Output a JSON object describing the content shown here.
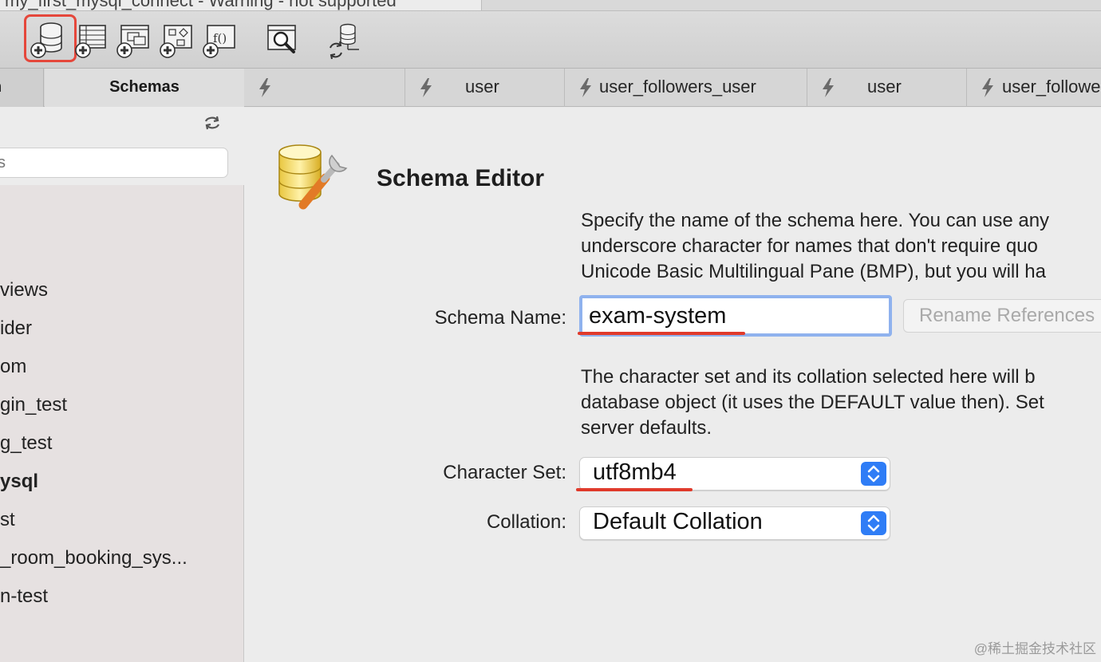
{
  "window": {
    "title": "my_first_mysql_connect - Warning - not supported"
  },
  "toolbar": {
    "buttons": [
      {
        "icon": "new-schema-icon",
        "highlighted": true
      },
      {
        "icon": "new-table-icon"
      },
      {
        "icon": "new-view-icon"
      },
      {
        "icon": "new-procedure-icon"
      },
      {
        "icon": "new-function-icon"
      },
      {
        "icon": "inspector-icon"
      },
      {
        "icon": "reconnect-icon"
      }
    ],
    "highlight_color": "#e5473b"
  },
  "sidebar": {
    "tab_left": "n",
    "tab_schemas": "Schemas",
    "search_placeholder": "s",
    "schemas": [
      {
        "name": "views",
        "bold": false
      },
      {
        "name": "ider",
        "bold": false
      },
      {
        "name": "om",
        "bold": false
      },
      {
        "name": "gin_test",
        "bold": false
      },
      {
        "name": "g_test",
        "bold": false
      },
      {
        "name": "ysql",
        "bold": true
      },
      {
        "name": "st",
        "bold": false
      },
      {
        "name": "_room_booking_sys...",
        "bold": false
      },
      {
        "name": "n-test",
        "bold": false
      }
    ]
  },
  "doc_tabs": [
    {
      "label": ""
    },
    {
      "label": "user"
    },
    {
      "label": "user_followers_user"
    },
    {
      "label": "user"
    },
    {
      "label": "user_followe"
    }
  ],
  "editor": {
    "title": "Schema Editor",
    "description_lines": [
      "Specify the name of the schema here. You can use any",
      "underscore character for names that don't require quo",
      "Unicode Basic Multilingual Pane (BMP), but you will ha"
    ],
    "schema_name_label": "Schema Name:",
    "schema_name_value": "exam-system",
    "rename_button": "Rename References",
    "charset_description_lines": [
      "The character set and its collation selected here will b",
      "database object (it uses the DEFAULT value then). Set",
      "server defaults."
    ],
    "charset_label": "Character Set:",
    "charset_value": "utf8mb4",
    "collation_label": "Collation:",
    "collation_value": "Default Collation",
    "accent_color": "#2f7df6",
    "annotation_color": "#e03a2b"
  },
  "watermark": "@稀土掘金技术社区"
}
